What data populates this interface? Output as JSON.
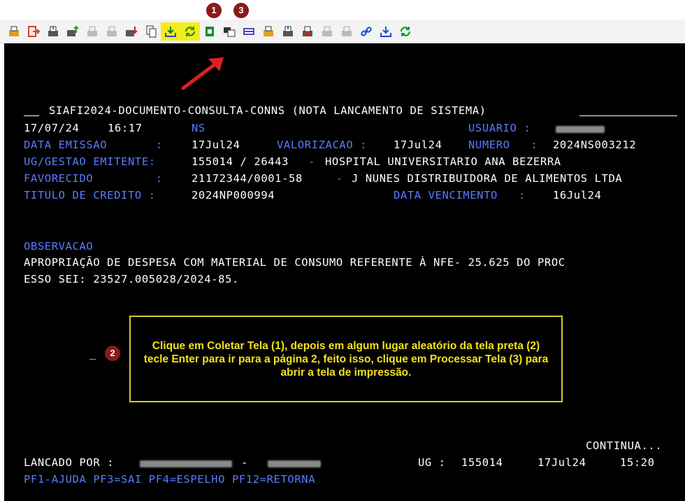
{
  "annotations": {
    "badge1": "1",
    "badge2": "2",
    "badge3": "3"
  },
  "toolbar": {
    "icons": [
      "open-folder-icon",
      "exit-icon",
      "print-screen-icon",
      "transfer-up-icon",
      "print-disabled-icon",
      "print-disabled-2-icon",
      "transfer-down-icon",
      "copy-icon",
      "coletar-tela-icon",
      "processar-tela-icon",
      "spreadsheet-icon",
      "copy-window-icon",
      "keyboard-icon",
      "folder-icon",
      "print-green-icon",
      "print-red-icon",
      "print-gray-icon",
      "print-gray-2-icon",
      "link-icon",
      "download-icon",
      "refresh-icon"
    ],
    "highlight_color": "#f6ec1a"
  },
  "terminal": {
    "header_title": "SIAFI2024-DOCUMENTO-CONSULTA-CONNS (NOTA LANCAMENTO DE SISTEMA)",
    "date": "17/07/24",
    "time": "16:17",
    "doc_type": "NS",
    "usuario_label": "USUARIO :",
    "data_emissao_label": "DATA EMISSAO       :",
    "data_emissao": "17Jul24",
    "valorizacao_label": "VALORIZACAO :",
    "valorizacao": "17Jul24",
    "numero_label": "NUMERO   :",
    "numero": "2024NS003212",
    "ug_label": "UG/GESTAO EMITENTE:",
    "ug_value": "155014 / 26443",
    "ug_sep": "-",
    "ug_name": "HOSPITAL UNIVERSITARIO ANA BEZERRA",
    "favorecido_label": "FAVORECIDO         :",
    "favorecido_value": "21172344/0001-58",
    "favorecido_sep": "-",
    "favorecido_name": "J NUNES DISTRIBUIDORA DE ALIMENTOS LTDA",
    "titulo_label": "TITULO DE CREDITO :",
    "titulo_value": "2024NP000994",
    "vencimento_label": "DATA VENCIMENTO   :",
    "vencimento_value": "16Jul24",
    "observacao_label": "OBSERVACAO",
    "observacao_line1": "APROPRIAÇÃO DE DESPESA COM MATERIAL DE CONSUMO REFERENTE À NFE- 25.625 DO PROC",
    "observacao_line2": "ESSO SEI: 23527.005028/2024-85.",
    "cursor": "_",
    "continua": "CONTINUA...",
    "lancado_label": "LANCADO POR :",
    "lancado_sep": "-",
    "ug_footer_label": "UG :",
    "ug_footer_value": "155014",
    "footer_date": "17Jul24",
    "footer_time": "15:20",
    "pf_keys": "PF1-AJUDA PF3=SAI PF4=ESPELHO PF12=RETORNA"
  },
  "tooltip": {
    "text": "Clique em Coletar Tela (1), depois em algum lugar aleatório da tela preta (2) tecle Enter para ir para a página 2, feito isso, clique em Processar Tela (3) para abrir a tela de impressão."
  },
  "colors": {
    "terminal_bg": "#000000",
    "terminal_cyan": "#5a7bff",
    "terminal_white": "#ffffff",
    "tooltip_text": "#f3e11d",
    "tooltip_border": "#d9c628",
    "badge": "#8b1a1a",
    "arrow": "#e02020"
  }
}
